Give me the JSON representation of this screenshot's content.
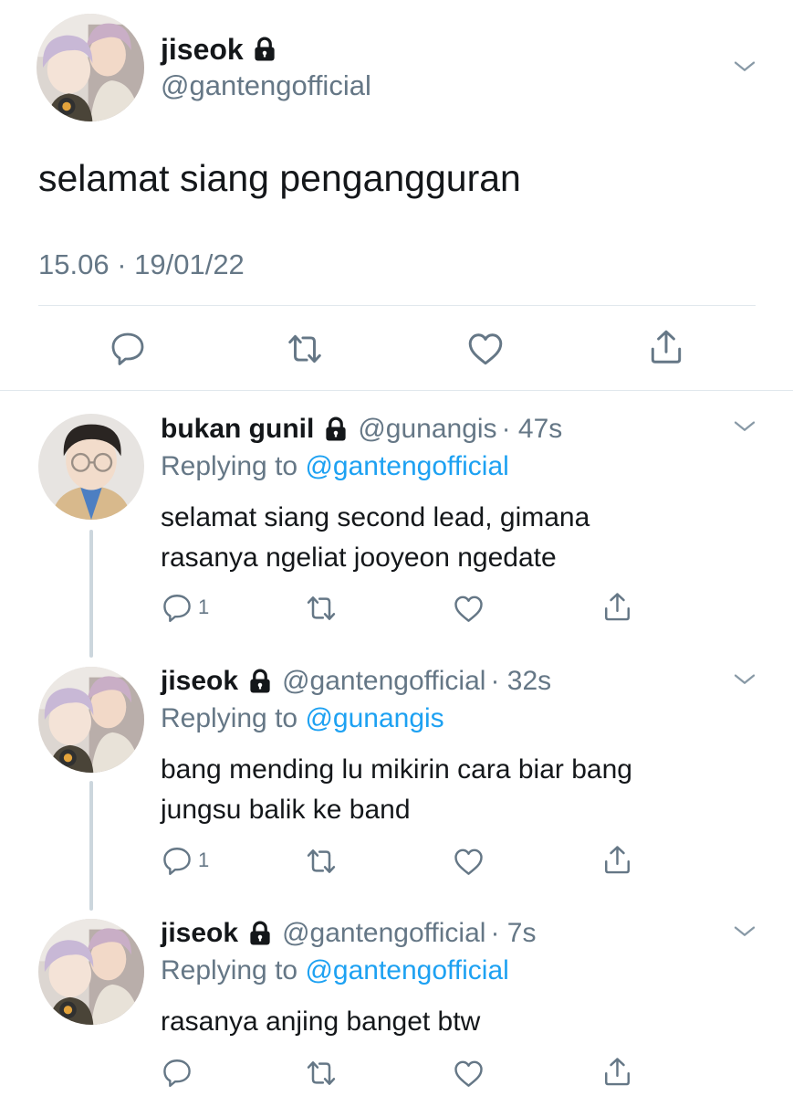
{
  "main_tweet": {
    "display_name": "jiseok",
    "handle": "@gantengofficial",
    "text": "selamat siang pengangguran",
    "timestamp": "15.06 · 19/01/22"
  },
  "replies": [
    {
      "display_name": "bukan gunil",
      "handle": "@gunangis",
      "time": "· 47s",
      "replying_label": "Replying to",
      "replying_to": "@gantengofficial",
      "text_lines": [
        "selamat siang second lead, gimana",
        "rasanya ngeliat jooyeon ngedate"
      ],
      "reply_count": "1"
    },
    {
      "display_name": "jiseok",
      "handle": "@gantengofficial",
      "time": "· 32s",
      "replying_label": "Replying to",
      "replying_to": "@gunangis",
      "text_lines": [
        "bang mending lu mikirin cara biar bang",
        "jungsu balik ke band"
      ],
      "reply_count": "1"
    },
    {
      "display_name": "jiseok",
      "handle": "@gantengofficial",
      "time": "· 7s",
      "replying_label": "Replying to",
      "replying_to": "@gantengofficial",
      "text_lines": [
        "rasanya anjing banget btw"
      ],
      "reply_count": ""
    }
  ],
  "colors": {
    "text": "#14171a",
    "muted": "#657786",
    "link": "#1da1f2",
    "divider": "#e1e8ed",
    "thread_line": "#ccd6dd"
  },
  "icons": [
    "lock-icon",
    "chevron-down-icon",
    "reply-icon",
    "retweet-icon",
    "like-icon",
    "share-icon"
  ]
}
